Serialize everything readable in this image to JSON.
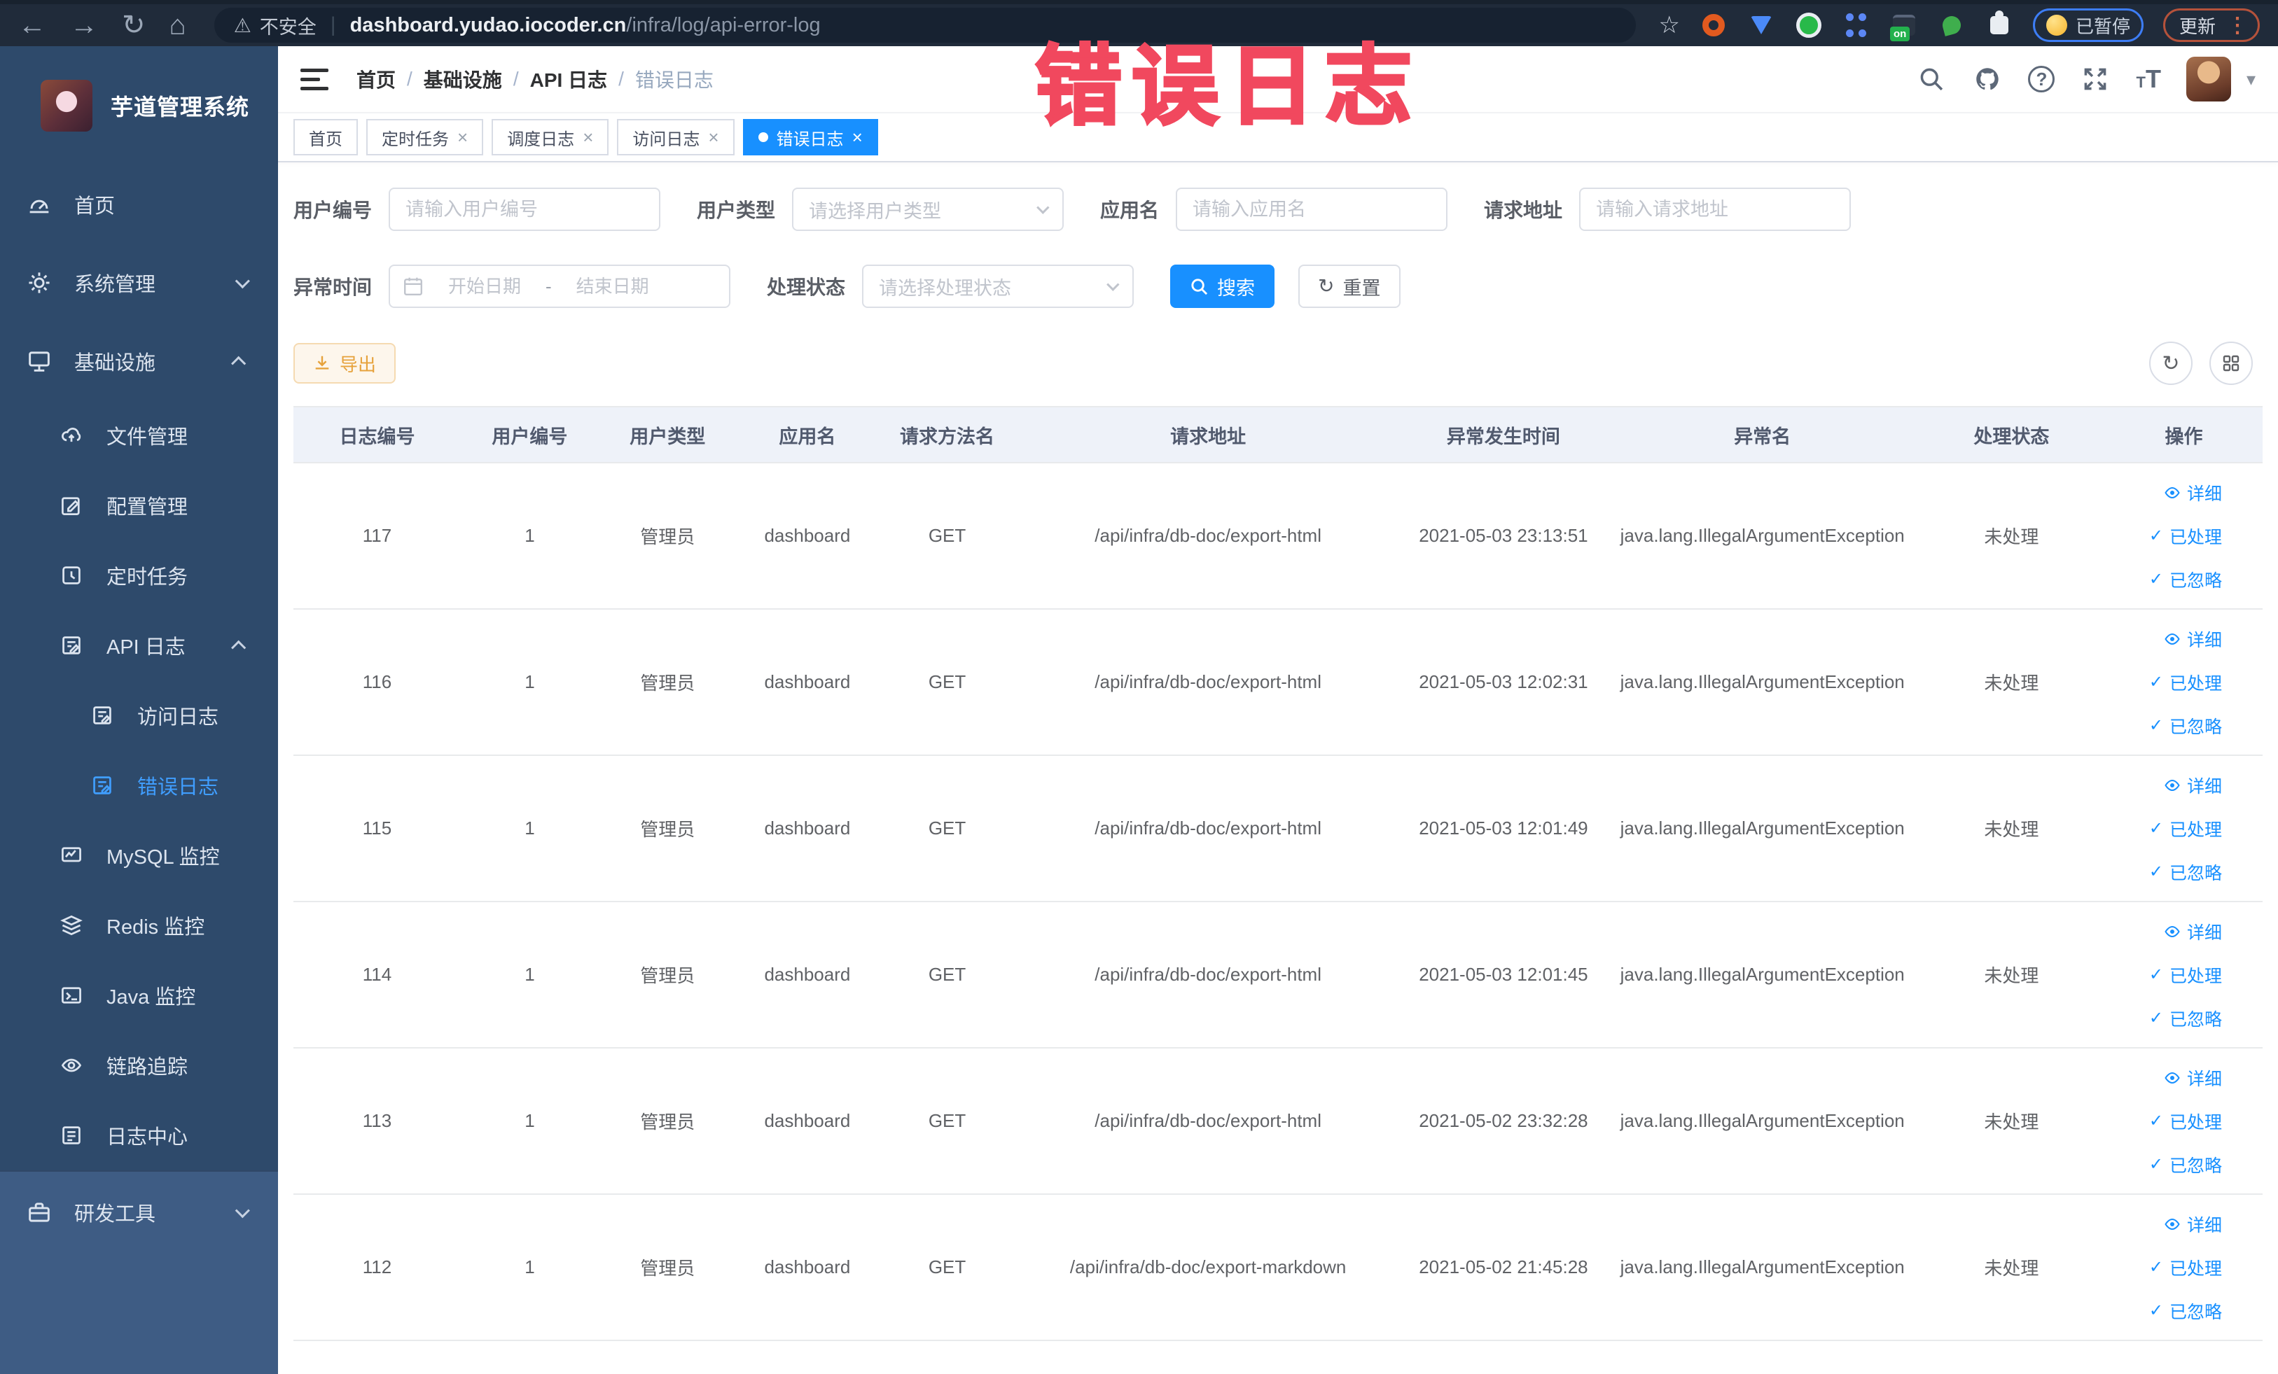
{
  "browser": {
    "security_label": "不安全",
    "url_domain": "dashboard.yudao.iocoder.cn",
    "url_path": "/infra/log/api-error-log",
    "extension_on_badge": "on",
    "paused_badge_label": "已暂停",
    "update_button_label": "更新"
  },
  "annotation": {
    "text": "错误日志",
    "color": "#f1485e"
  },
  "sidebar": {
    "app_title": "芋道管理系统",
    "items": {
      "home": "首页",
      "system": "系统管理",
      "infra": "基础设施",
      "file": "文件管理",
      "config": "配置管理",
      "job": "定时任务",
      "api_log": "API 日志",
      "access_log": "访问日志",
      "error_log": "错误日志",
      "mysql": "MySQL 监控",
      "redis": "Redis 监控",
      "java": "Java 监控",
      "trace": "链路追踪",
      "log_center": "日志中心",
      "devtools": "研发工具"
    }
  },
  "header": {
    "breadcrumb": [
      "首页",
      "基础设施",
      "API 日志",
      "错误日志"
    ],
    "separator": "/"
  },
  "tabs": [
    {
      "label": "首页"
    },
    {
      "label": "定时任务"
    },
    {
      "label": "调度日志"
    },
    {
      "label": "访问日志"
    },
    {
      "label": "错误日志"
    }
  ],
  "filters": {
    "user_id_label": "用户编号",
    "user_id_placeholder": "请输入用户编号",
    "user_type_label": "用户类型",
    "user_type_placeholder": "请选择用户类型",
    "app_name_label": "应用名",
    "app_name_placeholder": "请输入应用名",
    "request_url_label": "请求地址",
    "request_url_placeholder": "请输入请求地址",
    "time_label": "异常时间",
    "time_start_placeholder": "开始日期",
    "time_separator": "-",
    "time_end_placeholder": "结束日期",
    "status_label": "处理状态",
    "status_placeholder": "请选择处理状态",
    "search_button": "搜索",
    "reset_button": "重置"
  },
  "toolbar": {
    "export_label": "导出"
  },
  "table": {
    "columns": [
      "日志编号",
      "用户编号",
      "用户类型",
      "应用名",
      "请求方法名",
      "请求地址",
      "异常发生时间",
      "异常名",
      "处理状态",
      "操作"
    ],
    "rows": [
      {
        "log_id": "117",
        "user_id": "1",
        "user_type": "管理员",
        "app_name": "dashboard",
        "method": "GET",
        "url": "/api/infra/db-doc/export-html",
        "time": "2021-05-03 23:13:51",
        "exception": "java.lang.IllegalArgumentException",
        "status": "未处理"
      },
      {
        "log_id": "116",
        "user_id": "1",
        "user_type": "管理员",
        "app_name": "dashboard",
        "method": "GET",
        "url": "/api/infra/db-doc/export-html",
        "time": "2021-05-03 12:02:31",
        "exception": "java.lang.IllegalArgumentException",
        "status": "未处理"
      },
      {
        "log_id": "115",
        "user_id": "1",
        "user_type": "管理员",
        "app_name": "dashboard",
        "method": "GET",
        "url": "/api/infra/db-doc/export-html",
        "time": "2021-05-03 12:01:49",
        "exception": "java.lang.IllegalArgumentException",
        "status": "未处理"
      },
      {
        "log_id": "114",
        "user_id": "1",
        "user_type": "管理员",
        "app_name": "dashboard",
        "method": "GET",
        "url": "/api/infra/db-doc/export-html",
        "time": "2021-05-03 12:01:45",
        "exception": "java.lang.IllegalArgumentException",
        "status": "未处理"
      },
      {
        "log_id": "113",
        "user_id": "1",
        "user_type": "管理员",
        "app_name": "dashboard",
        "method": "GET",
        "url": "/api/infra/db-doc/export-html",
        "time": "2021-05-02 23:32:28",
        "exception": "java.lang.IllegalArgumentException",
        "status": "未处理"
      },
      {
        "log_id": "112",
        "user_id": "1",
        "user_type": "管理员",
        "app_name": "dashboard",
        "method": "GET",
        "url": "/api/infra/db-doc/export-markdown",
        "time": "2021-05-02 21:45:28",
        "exception": "java.lang.IllegalArgumentException",
        "status": "未处理"
      }
    ],
    "actions": {
      "detail": "详细",
      "processed": "已处理",
      "ignored": "已忽略"
    }
  },
  "glyphs": {
    "close": "×",
    "check": "✓",
    "back": "←",
    "forward": "→",
    "reload": "↻",
    "home": "⌂",
    "warning": "⚠",
    "star": "☆",
    "divider": "|",
    "ellipsis": "⋮",
    "caret": "▾",
    "question": "?",
    "font_t_big": "T",
    "font_t_small": "T",
    "refresh": "↻"
  },
  "colors": {
    "accent": "#1890ff",
    "sidebar_active": "#409eff",
    "warning": "#e6a23c",
    "annotation_red": "#f1485e"
  }
}
